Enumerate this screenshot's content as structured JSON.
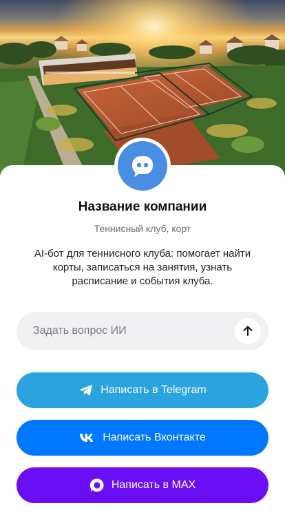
{
  "company": {
    "name": "Название компании",
    "category": "Теннисный клуб, корт",
    "description": "AI-бот для теннисного клуба: помогает найти корты, записаться на занятия, узнать расписание и события клуба."
  },
  "ask": {
    "placeholder": "Задать вопрос ИИ"
  },
  "buttons": {
    "telegram": {
      "label": "Написать в Telegram",
      "icon": "telegram-icon",
      "color": "#2aa3de"
    },
    "vk": {
      "label": "Написать Вконтакте",
      "icon": "vk-icon",
      "color": "#0077ff"
    },
    "max": {
      "label": "Написать в MAX",
      "icon": "max-icon",
      "color": "#6a0ff5"
    }
  },
  "avatar": {
    "icon": "chat-bubble-icon",
    "color": "#4a8ee3"
  }
}
